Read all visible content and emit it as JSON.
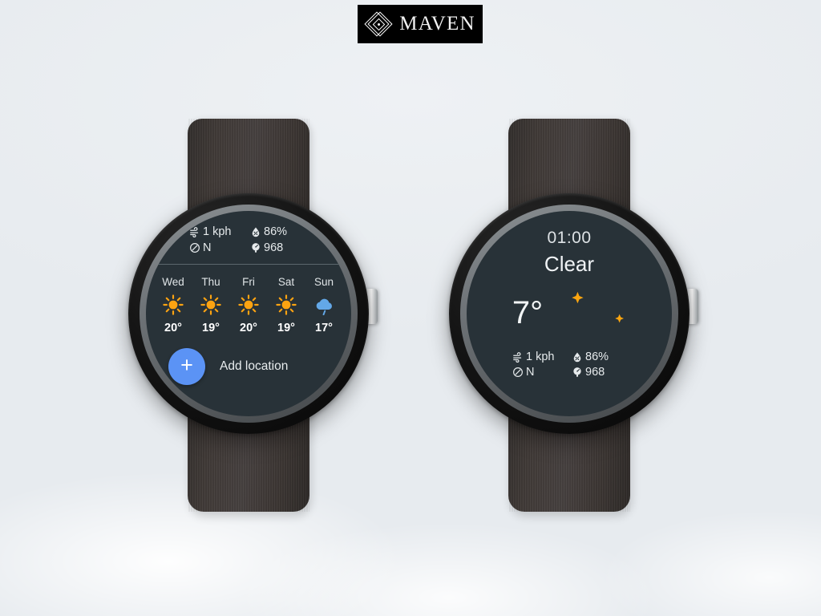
{
  "brand": {
    "name": "MAVEN",
    "mark_icon": "diamond-logo-icon"
  },
  "watches": {
    "left": {
      "screen_title": "forecast-list-screen",
      "conditions": {
        "wind": "1 kph",
        "humidity": "86%",
        "direction": "N",
        "pressure": "968",
        "wind_icon": "wind-icon",
        "humidity_icon": "humidity-droplet-icon",
        "direction_icon": "compass-icon",
        "pressure_icon": "pressure-gauge-icon"
      },
      "forecast": [
        {
          "day": "Wed",
          "icon": "sun-icon",
          "temp": "20°"
        },
        {
          "day": "Thu",
          "icon": "sun-icon",
          "temp": "19°"
        },
        {
          "day": "Fri",
          "icon": "sun-icon",
          "temp": "20°"
        },
        {
          "day": "Sat",
          "icon": "sun-icon",
          "temp": "19°"
        },
        {
          "day": "Sun",
          "icon": "rain-cloud-icon",
          "temp": "17°"
        }
      ],
      "add_location": {
        "label": "Add location",
        "fab_glyph": "+",
        "fab_icon": "plus-icon"
      }
    },
    "right": {
      "screen_title": "current-weather-screen",
      "time": "01:00",
      "condition": "Clear",
      "temperature": "7°",
      "weather_icon": "crescent-moon-icon",
      "conditions": {
        "wind": "1 kph",
        "humidity": "86%",
        "direction": "N",
        "pressure": "968",
        "wind_icon": "wind-icon",
        "humidity_icon": "humidity-droplet-icon",
        "direction_icon": "compass-icon",
        "pressure_icon": "pressure-gauge-icon"
      }
    }
  },
  "colors": {
    "screen_bg": "#283238",
    "accent_blue": "#5b93f5",
    "sun_orange": "#fca311",
    "moon_orange": "#fba510",
    "cloud_blue": "#63a8e8",
    "page_bg": "#e9edf1",
    "strap": "#413b38"
  }
}
